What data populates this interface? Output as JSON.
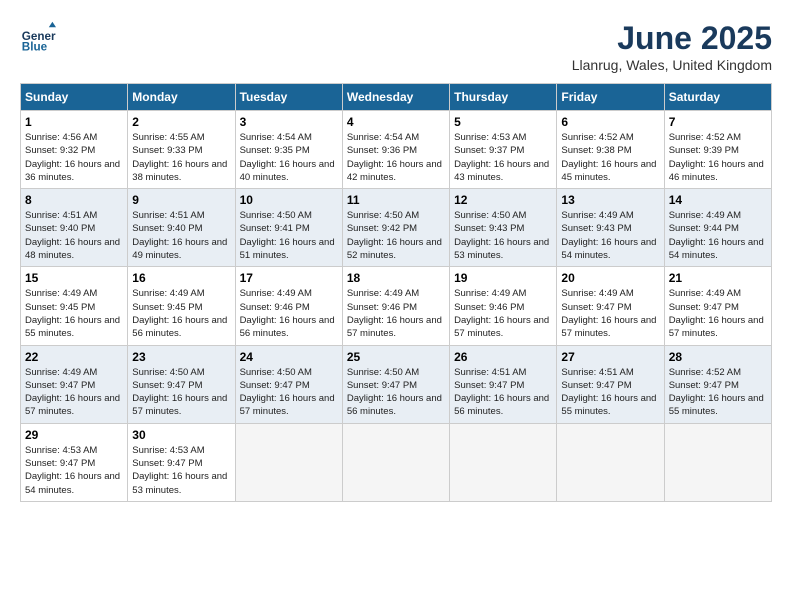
{
  "header": {
    "logo_line1": "General",
    "logo_line2": "Blue",
    "month": "June 2025",
    "location": "Llanrug, Wales, United Kingdom"
  },
  "weekdays": [
    "Sunday",
    "Monday",
    "Tuesday",
    "Wednesday",
    "Thursday",
    "Friday",
    "Saturday"
  ],
  "weeks": [
    [
      {
        "day": "1",
        "sunrise": "4:56 AM",
        "sunset": "9:32 PM",
        "daylight": "16 hours and 36 minutes."
      },
      {
        "day": "2",
        "sunrise": "4:55 AM",
        "sunset": "9:33 PM",
        "daylight": "16 hours and 38 minutes."
      },
      {
        "day": "3",
        "sunrise": "4:54 AM",
        "sunset": "9:35 PM",
        "daylight": "16 hours and 40 minutes."
      },
      {
        "day": "4",
        "sunrise": "4:54 AM",
        "sunset": "9:36 PM",
        "daylight": "16 hours and 42 minutes."
      },
      {
        "day": "5",
        "sunrise": "4:53 AM",
        "sunset": "9:37 PM",
        "daylight": "16 hours and 43 minutes."
      },
      {
        "day": "6",
        "sunrise": "4:52 AM",
        "sunset": "9:38 PM",
        "daylight": "16 hours and 45 minutes."
      },
      {
        "day": "7",
        "sunrise": "4:52 AM",
        "sunset": "9:39 PM",
        "daylight": "16 hours and 46 minutes."
      }
    ],
    [
      {
        "day": "8",
        "sunrise": "4:51 AM",
        "sunset": "9:40 PM",
        "daylight": "16 hours and 48 minutes."
      },
      {
        "day": "9",
        "sunrise": "4:51 AM",
        "sunset": "9:40 PM",
        "daylight": "16 hours and 49 minutes."
      },
      {
        "day": "10",
        "sunrise": "4:50 AM",
        "sunset": "9:41 PM",
        "daylight": "16 hours and 51 minutes."
      },
      {
        "day": "11",
        "sunrise": "4:50 AM",
        "sunset": "9:42 PM",
        "daylight": "16 hours and 52 minutes."
      },
      {
        "day": "12",
        "sunrise": "4:50 AM",
        "sunset": "9:43 PM",
        "daylight": "16 hours and 53 minutes."
      },
      {
        "day": "13",
        "sunrise": "4:49 AM",
        "sunset": "9:43 PM",
        "daylight": "16 hours and 54 minutes."
      },
      {
        "day": "14",
        "sunrise": "4:49 AM",
        "sunset": "9:44 PM",
        "daylight": "16 hours and 54 minutes."
      }
    ],
    [
      {
        "day": "15",
        "sunrise": "4:49 AM",
        "sunset": "9:45 PM",
        "daylight": "16 hours and 55 minutes."
      },
      {
        "day": "16",
        "sunrise": "4:49 AM",
        "sunset": "9:45 PM",
        "daylight": "16 hours and 56 minutes."
      },
      {
        "day": "17",
        "sunrise": "4:49 AM",
        "sunset": "9:46 PM",
        "daylight": "16 hours and 56 minutes."
      },
      {
        "day": "18",
        "sunrise": "4:49 AM",
        "sunset": "9:46 PM",
        "daylight": "16 hours and 57 minutes."
      },
      {
        "day": "19",
        "sunrise": "4:49 AM",
        "sunset": "9:46 PM",
        "daylight": "16 hours and 57 minutes."
      },
      {
        "day": "20",
        "sunrise": "4:49 AM",
        "sunset": "9:47 PM",
        "daylight": "16 hours and 57 minutes."
      },
      {
        "day": "21",
        "sunrise": "4:49 AM",
        "sunset": "9:47 PM",
        "daylight": "16 hours and 57 minutes."
      }
    ],
    [
      {
        "day": "22",
        "sunrise": "4:49 AM",
        "sunset": "9:47 PM",
        "daylight": "16 hours and 57 minutes."
      },
      {
        "day": "23",
        "sunrise": "4:50 AM",
        "sunset": "9:47 PM",
        "daylight": "16 hours and 57 minutes."
      },
      {
        "day": "24",
        "sunrise": "4:50 AM",
        "sunset": "9:47 PM",
        "daylight": "16 hours and 57 minutes."
      },
      {
        "day": "25",
        "sunrise": "4:50 AM",
        "sunset": "9:47 PM",
        "daylight": "16 hours and 56 minutes."
      },
      {
        "day": "26",
        "sunrise": "4:51 AM",
        "sunset": "9:47 PM",
        "daylight": "16 hours and 56 minutes."
      },
      {
        "day": "27",
        "sunrise": "4:51 AM",
        "sunset": "9:47 PM",
        "daylight": "16 hours and 55 minutes."
      },
      {
        "day": "28",
        "sunrise": "4:52 AM",
        "sunset": "9:47 PM",
        "daylight": "16 hours and 55 minutes."
      }
    ],
    [
      {
        "day": "29",
        "sunrise": "4:53 AM",
        "sunset": "9:47 PM",
        "daylight": "16 hours and 54 minutes."
      },
      {
        "day": "30",
        "sunrise": "4:53 AM",
        "sunset": "9:47 PM",
        "daylight": "16 hours and 53 minutes."
      },
      null,
      null,
      null,
      null,
      null
    ]
  ]
}
